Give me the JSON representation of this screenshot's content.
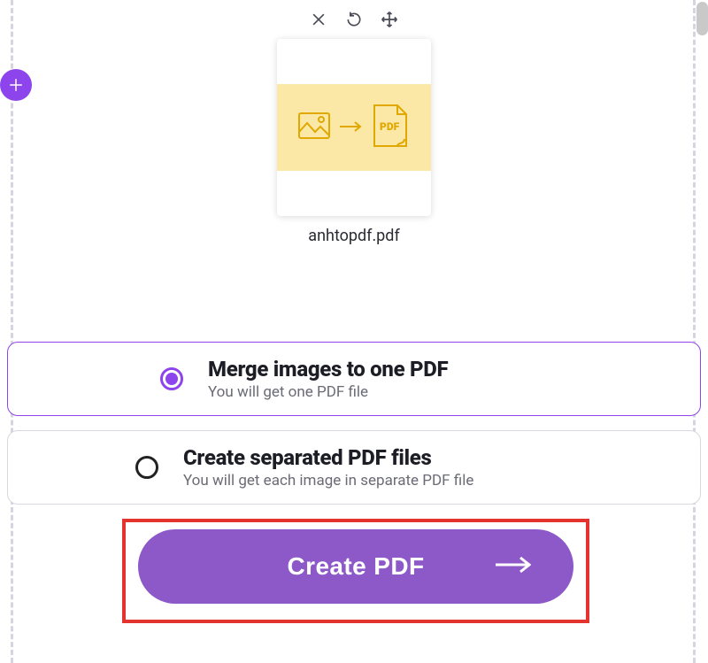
{
  "file": {
    "name": "anhtopdf.pdf",
    "preview_badge": "PDF"
  },
  "toolbar": {
    "delete": "Remove file",
    "rotate": "Rotate",
    "move": "Drag to reorder"
  },
  "fab_label": "Add file",
  "options": {
    "merge": {
      "title": "Merge images to one PDF",
      "sub": "You will get one PDF file",
      "selected": true
    },
    "separate": {
      "title": "Create separated PDF files",
      "sub": "You will get each image in separate PDF file",
      "selected": false
    }
  },
  "cta_label": "Create PDF",
  "colors": {
    "accent": "#8e44ec"
  }
}
